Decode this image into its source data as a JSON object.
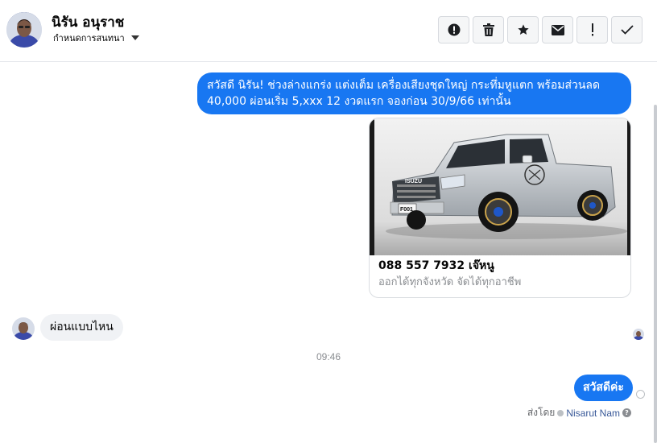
{
  "header": {
    "contact_name": "นิรัน อนุราช",
    "subtitle": "กำหนดการสนทนา",
    "toolbar": [
      {
        "name": "report-button",
        "icon": "alert-circle-icon"
      },
      {
        "name": "delete-button",
        "icon": "trash-icon"
      },
      {
        "name": "star-button",
        "icon": "star-icon"
      },
      {
        "name": "mark-unread-button",
        "icon": "envelope-icon"
      },
      {
        "name": "mark-spam-button",
        "icon": "exclamation-icon"
      },
      {
        "name": "mark-done-button",
        "icon": "checkmark-icon"
      }
    ]
  },
  "thread": {
    "outgoing_message": "สวัสดี นิรัน! ช่วงล่างแกร่ง แต่งเต็ม เครื่องเสียงชุดใหญ่ กระทึ่มหูแตก พร้อมส่วนลด 40,000 ผ่อนเริ่ม 5,xxx 12 งวดแรก จองก่อน 30/9/66 เท่านั้น",
    "card": {
      "title": "088 557 7932 เจ๊หนู",
      "subtitle": "ออกได้ทุกจังหวัด จัดได้ทุกอาชีพ",
      "image_icon": "pickup-truck-photo",
      "brand_text": "ISUZU",
      "plate_text": "F001"
    },
    "incoming_message": "ผ่อนแบบไหน",
    "timestamp": "09:46",
    "reply_message": "สวัสดีค่ะ",
    "sent_by_label": "ส่งโดย",
    "sent_by_name": "Nisarut Nam"
  },
  "colors": {
    "accent": "#1877f2",
    "incoming_bubble": "#f0f2f5",
    "meta_text": "#8a8d91"
  }
}
